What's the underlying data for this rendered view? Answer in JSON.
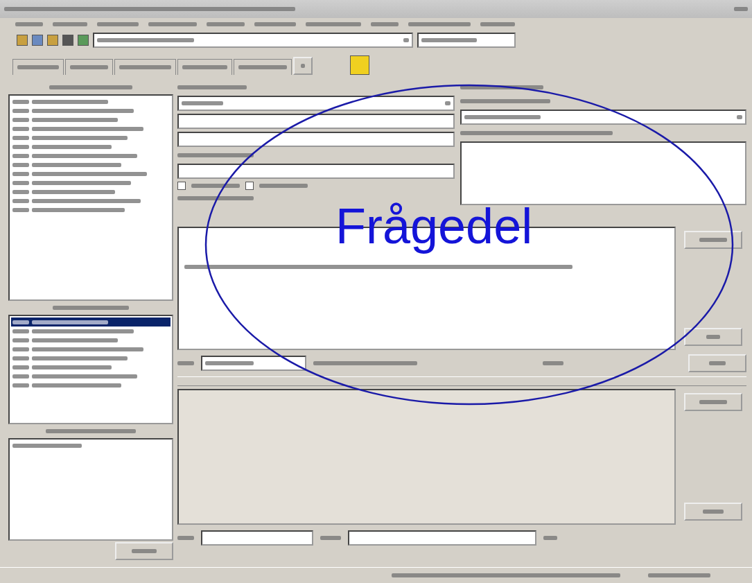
{
  "annotation": {
    "label": "Frågedel"
  },
  "lists": [
    {
      "rows": [
        {
          "selected": false
        },
        {
          "selected": false
        },
        {
          "selected": false
        },
        {
          "selected": false
        },
        {
          "selected": false
        },
        {
          "selected": false
        },
        {
          "selected": false
        },
        {
          "selected": false
        },
        {
          "selected": false
        },
        {
          "selected": false
        },
        {
          "selected": false
        },
        {
          "selected": false
        },
        {
          "selected": false
        }
      ]
    },
    {
      "rows": [
        {
          "selected": true
        },
        {
          "selected": false
        },
        {
          "selected": false
        },
        {
          "selected": false
        },
        {
          "selected": false
        },
        {
          "selected": false
        },
        {
          "selected": false
        },
        {
          "selected": false
        }
      ]
    }
  ],
  "options": [
    {
      "checked": false
    },
    {
      "checked": false
    }
  ]
}
